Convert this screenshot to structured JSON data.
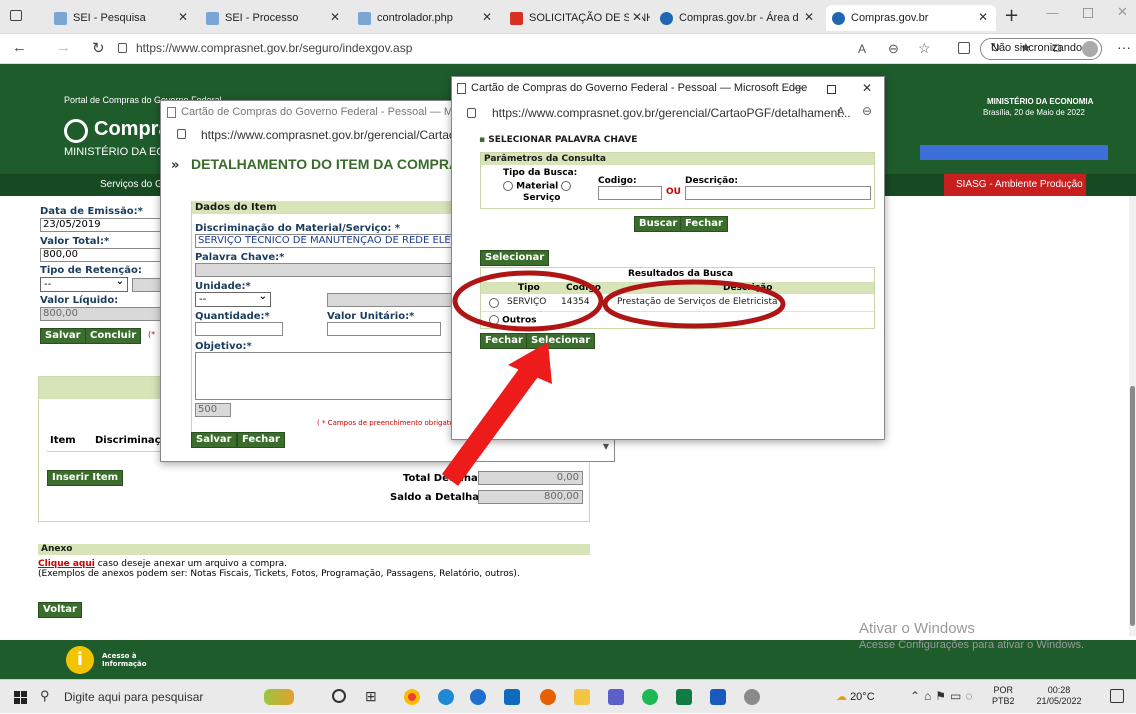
{
  "browser": {
    "tabs": [
      {
        "label": "SEI - Pesquisa",
        "fav": "#7aa6d6"
      },
      {
        "label": "SEI - Processo",
        "fav": "#7aa6d6"
      },
      {
        "label": "controlador.php",
        "fav": "#7aa6d6"
      },
      {
        "label": "SOLICITAÇÃO DE SENHA",
        "fav": "#d93025"
      },
      {
        "label": "Compras.gov.br - Área d",
        "fav": "#1f66b3"
      },
      {
        "label": "Compras.gov.br",
        "fav": "#1f66b3"
      }
    ],
    "url": "https://www.comprasnet.gov.br/seguro/indexgov.asp",
    "profile": "Não sincronizando"
  },
  "portal": {
    "title": "Portal de Compras do Governo Federal",
    "logo": "Compras",
    "ministry_left": "MINISTÉRIO DA EC",
    "ministry_right": "MINISTÉRIO DA ECONOMIA",
    "date": "Brasília, 20 de Maio de 2022",
    "menu_left": "Serviços do G",
    "menu_right": "SIASG - Ambiente Produção"
  },
  "form": {
    "data_emissao_label": "Data de Emissão:*",
    "data_emissao": "23/05/2019",
    "valor_total_label": "Valor Total:*",
    "valor_total": "800,00",
    "tipo_retencao_label": "Tipo de Retenção:",
    "tipo_retencao": "--",
    "valor_liquido_label": "Valor Líquido:",
    "valor_liquido": "800,00",
    "salvar": "Salvar",
    "concluir": "Concluir",
    "item_col": "Item",
    "discrim_col": "Discriminação",
    "inserir_item": "Inserir Item",
    "total_detalhado_label": "Total Detalhado:",
    "total_detalhado": "0,00",
    "saldo_label": "Saldo a Detalhar:",
    "saldo": "800,00",
    "anexo_title": "Anexo",
    "anexo_link": "Clique aqui",
    "anexo_text": " caso deseje anexar um arquivo a compra.",
    "anexo_examples": "(Exemplos de anexos podem ser: Notas Fiscais, Tickets, Fotos, Programação, Passagens, Relatório, outros).",
    "voltar": "Voltar",
    "acesso": "Acesso à Informação"
  },
  "window2": {
    "title": "Cartão de Compras do Governo Federal - Pessoal — Microsoft Ed",
    "url": "https://www.comprasnet.gov.br/gerencial/CartaoPG",
    "heading": "DETALHAMENTO DO ITEM DA COMPRA",
    "dados_item": "Dados do Item",
    "discrim_label": "Discriminação do Material/Serviço: *",
    "discrim_value": "SERVIÇO TÉCNICO DE MANUTENÇÃO DE REDE ELÉTR",
    "palavra_label": "Palavra Chave:*",
    "unidade_label": "Unidade:*",
    "unidade_value": "--",
    "quantidade_label": "Quantidade:*",
    "valor_unit_label": "Valor Unitário:*",
    "objetivo_label": "Objetivo:*",
    "counter": "500",
    "required_note": "( * Campos de preenchimento obrigatório",
    "salvar": "Salvar",
    "fechar": "Fechar"
  },
  "window3": {
    "title": "Cartão de Compras do Governo Federal - Pessoal — Microsoft Edge",
    "url": "https://www.comprasnet.gov.br/gerencial/CartaoPGF/detalhament...",
    "heading": "SELECIONAR PALAVRA CHAVE",
    "params": "Parâmetros da Consulta",
    "tipo_busca": "Tipo da Busca:",
    "material": "Material",
    "servico": "Serviço",
    "codigo_label": "Codigo:",
    "ou": "OU",
    "descricao_label": "Descrição:",
    "buscar": "Buscar",
    "fechar": "Fechar",
    "selecionar_top": "Selecionar",
    "resultados": "Resultados da Busca",
    "col_tipo": "Tipo",
    "col_codigo": "Codigo",
    "col_descricao": "Descrição",
    "row_tipo": "SERVIÇO",
    "row_codigo": "14354",
    "row_descricao": "Prestação de Serviços de Eletricista",
    "outros": "Outros",
    "fechar_bottom": "Fechar",
    "selecionar_bottom": "Selecionar"
  },
  "watermark": {
    "title": "Ativar o Windows",
    "sub": "Acesse Configurações para ativar o Windows."
  },
  "taskbar": {
    "search": "Digite aqui para pesquisar",
    "weather": "20°C",
    "lang": "POR",
    "lang2": "PTB2",
    "time": "00:28",
    "date": "21/05/2022"
  }
}
